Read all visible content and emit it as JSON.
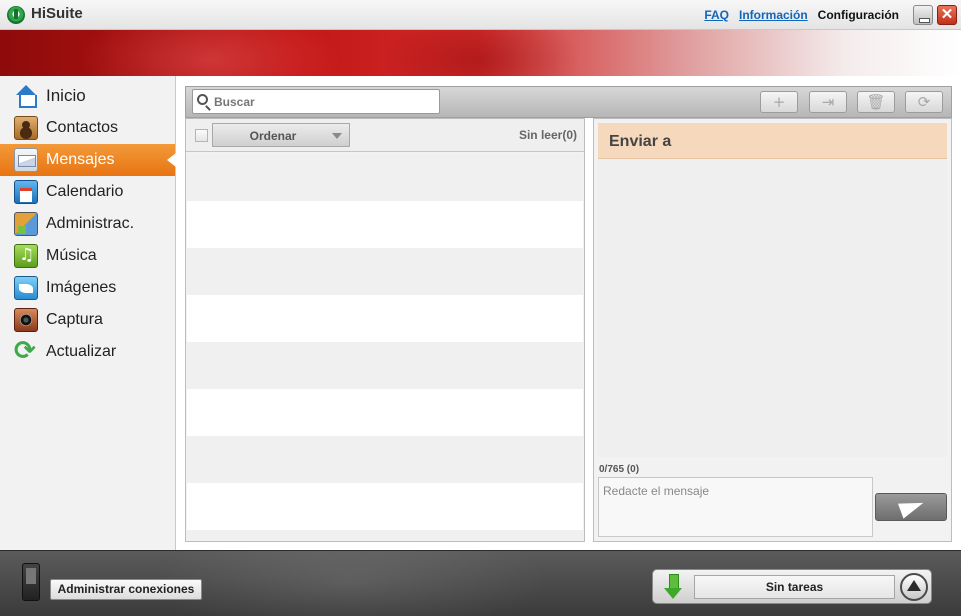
{
  "app": {
    "title": "HiSuite"
  },
  "header_links": {
    "faq": "FAQ",
    "info": "Información",
    "settings": "Configuración"
  },
  "window_controls": {
    "close": "✕"
  },
  "sidebar": {
    "items": [
      {
        "label": "Inicio",
        "icon": "home-icon"
      },
      {
        "label": "Contactos",
        "icon": "contacts-icon"
      },
      {
        "label": "Mensajes",
        "icon": "messages-icon",
        "active": true
      },
      {
        "label": "Calendario",
        "icon": "calendar-icon"
      },
      {
        "label": "Administrac.",
        "icon": "admin-icon"
      },
      {
        "label": "Música",
        "icon": "music-icon"
      },
      {
        "label": "Imágenes",
        "icon": "images-icon"
      },
      {
        "label": "Captura",
        "icon": "capture-icon"
      },
      {
        "label": "Actualizar",
        "icon": "update-icon"
      }
    ]
  },
  "toolbar": {
    "search_placeholder": "Buscar",
    "new_icon": "plus-icon",
    "export_icon": "export-icon",
    "delete_icon": "trash-icon",
    "refresh_icon": "refresh-icon"
  },
  "message_list": {
    "sort_label": "Ordenar",
    "unread_label": "Sin leer(0)"
  },
  "send_panel": {
    "title": "Enviar a",
    "char_count": "0/765 (0)",
    "message_placeholder": "Redacte el mensaje"
  },
  "bottom_bar": {
    "manage_connections": "Administrar conexiones",
    "task_status": "Sin tareas"
  },
  "colors": {
    "accent_orange": "#e87412",
    "send_header": "#f6d9bd",
    "banner_red": "#c21616"
  }
}
